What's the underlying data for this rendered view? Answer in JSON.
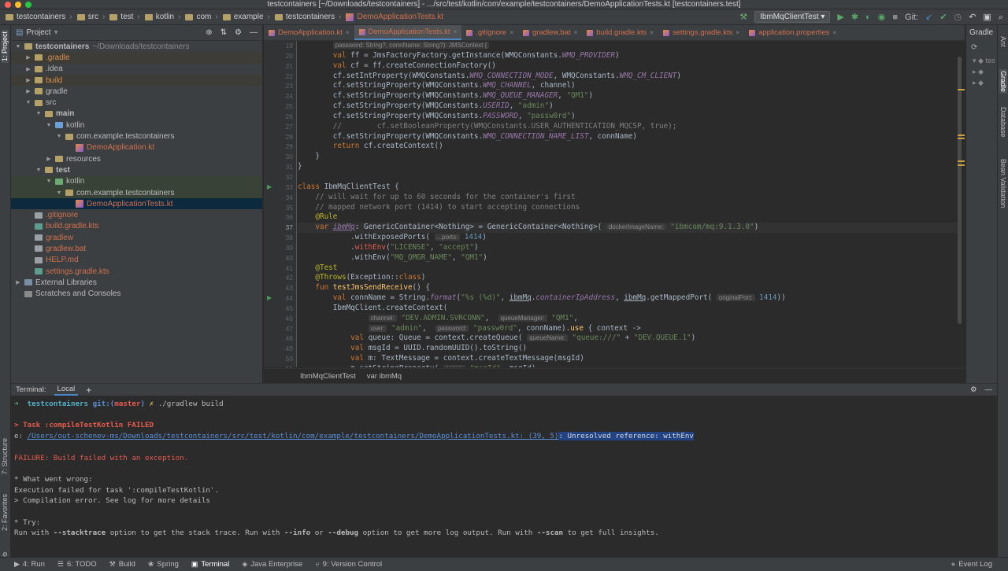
{
  "window": {
    "title": "testcontainers [~/Downloads/testcontainers] - .../src/test/kotlin/com/example/testcontainers/DemoApplicationTests.kt [testcontainers.test]"
  },
  "breadcrumbs": [
    "testcontainers",
    "src",
    "test",
    "kotlin",
    "com",
    "example",
    "testcontainers",
    "DemoApplicationTests.kt"
  ],
  "toolbar": {
    "run_config": "IbmMqClientTest",
    "git_label": "Git:"
  },
  "project": {
    "title": "Project",
    "tree": [
      {
        "label": "testcontainers",
        "suffix": "~/Downloads/testcontainers",
        "indent": 0,
        "arrow": "down",
        "icon": "folder",
        "style": "bold",
        "bg": ""
      },
      {
        "label": ".gradle",
        "indent": 1,
        "arrow": "right",
        "icon": "folder",
        "style": "orange",
        "bg": "ex"
      },
      {
        "label": ".idea",
        "indent": 1,
        "arrow": "right",
        "icon": "folder",
        "style": "",
        "bg": ""
      },
      {
        "label": "build",
        "indent": 1,
        "arrow": "right",
        "icon": "folder",
        "style": "orange",
        "bg": "ex"
      },
      {
        "label": "gradle",
        "indent": 1,
        "arrow": "right",
        "icon": "folder",
        "style": "",
        "bg": ""
      },
      {
        "label": "src",
        "indent": 1,
        "arrow": "down",
        "icon": "folder",
        "style": "",
        "bg": ""
      },
      {
        "label": "main",
        "indent": 2,
        "arrow": "down",
        "icon": "folder",
        "style": "bold",
        "bg": ""
      },
      {
        "label": "kotlin",
        "indent": 3,
        "arrow": "down",
        "icon": "folder-blue",
        "style": "",
        "bg": ""
      },
      {
        "label": "com.example.testcontainers",
        "indent": 4,
        "arrow": "down",
        "icon": "folder",
        "style": "",
        "bg": ""
      },
      {
        "label": "DemoApplication.kt",
        "indent": 5,
        "arrow": "",
        "icon": "kotlin",
        "style": "red",
        "bg": ""
      },
      {
        "label": "resources",
        "indent": 3,
        "arrow": "right",
        "icon": "folder",
        "style": "",
        "bg": ""
      },
      {
        "label": "test",
        "indent": 2,
        "arrow": "down",
        "icon": "folder",
        "style": "bold",
        "bg": ""
      },
      {
        "label": "kotlin",
        "indent": 3,
        "arrow": "down",
        "icon": "folder-green",
        "style": "",
        "bg": "test"
      },
      {
        "label": "com.example.testcontainers",
        "indent": 4,
        "arrow": "down",
        "icon": "folder",
        "style": "",
        "bg": "test"
      },
      {
        "label": "DemoApplicationTests.kt",
        "indent": 5,
        "arrow": "",
        "icon": "kotlin",
        "style": "red",
        "bg": "sel"
      },
      {
        "label": ".gitignore",
        "indent": 1,
        "arrow": "",
        "icon": "file",
        "style": "red",
        "bg": ""
      },
      {
        "label": "build.gradle.kts",
        "indent": 1,
        "arrow": "",
        "icon": "gradle",
        "style": "red",
        "bg": ""
      },
      {
        "label": "gradlew",
        "indent": 1,
        "arrow": "",
        "icon": "file",
        "style": "red",
        "bg": ""
      },
      {
        "label": "gradlew.bat",
        "indent": 1,
        "arrow": "",
        "icon": "file",
        "style": "red",
        "bg": ""
      },
      {
        "label": "HELP.md",
        "indent": 1,
        "arrow": "",
        "icon": "file",
        "style": "red",
        "bg": ""
      },
      {
        "label": "settings.gradle.kts",
        "indent": 1,
        "arrow": "",
        "icon": "gradle",
        "style": "red",
        "bg": ""
      },
      {
        "label": "External Libraries",
        "indent": 0,
        "arrow": "right",
        "icon": "lib",
        "style": "",
        "bg": ""
      },
      {
        "label": "Scratches and Consoles",
        "indent": 0,
        "arrow": "",
        "icon": "scratch",
        "style": "",
        "bg": ""
      }
    ]
  },
  "editor_tabs": [
    {
      "label": "DemoApplication.kt",
      "active": false
    },
    {
      "label": "DemoApplicationTests.kt",
      "active": true
    },
    {
      "label": ".gitignore",
      "active": false
    },
    {
      "label": "gradlew.bat",
      "active": false
    },
    {
      "label": "build.gradle.kts",
      "active": false
    },
    {
      "label": "settings.gradle.kts",
      "active": false
    },
    {
      "label": "application.properties",
      "active": false
    }
  ],
  "editor": {
    "line_numbers": [
      "19",
      "20",
      "21",
      "22",
      "23",
      "24",
      "25",
      "26",
      "27",
      "28",
      "29",
      "30",
      "31",
      "32",
      "33",
      "34",
      "35",
      "36",
      "37",
      "38",
      "39",
      "40",
      "41",
      "42",
      "43",
      "44",
      "45",
      "46",
      "47",
      "48",
      "49",
      "50",
      "51"
    ],
    "current_line": "37",
    "footer": [
      "IbmMqClientTest",
      "var ibmMq"
    ]
  },
  "gradle_panel": {
    "title": "Gradle"
  },
  "left_strip": [
    "1: Project",
    "7: Structure",
    "2: Favorites",
    "Web"
  ],
  "right_strip": [
    "Ant",
    "Gradle",
    "Database",
    "Bean Validation"
  ],
  "terminal": {
    "title": "Terminal:",
    "tab": "Local",
    "prompt_dir": "testcontainers",
    "prompt_git": "git:(",
    "prompt_branch": "master",
    "prompt_git_close": ")",
    "prompt_x": "✗",
    "command": "./gradlew build",
    "task_failed": "> Task :compileTestKotlin FAILED",
    "error_prefix": "e: ",
    "error_path": "/Users/out-schenev-ms/Downloads/testcontainers/src/test/kotlin/com/example/testcontainers/DemoApplicationTests.kt: (39, 5)",
    "error_msg": ": Unresolved reference: withEnv",
    "failure": "FAILURE: Build failed with an exception.",
    "what_wrong": "* What went wrong:",
    "exec_failed": "Execution failed for task ':compileTestKotlin'.",
    "compile_error": "> Compilation error. See log for more details",
    "try": "* Try:",
    "run_with": "Run with ",
    "stacktrace": "--stacktrace",
    "mid1": " option to get the stack trace. Run with ",
    "info": "--info",
    "mid2": " or ",
    "debug": "--debug",
    "mid3": " option to get more log output. Run with ",
    "scan": "--scan",
    "end": " to get full insights."
  },
  "statusbar": [
    {
      "icon": "▶",
      "label": "4: Run"
    },
    {
      "icon": "☰",
      "label": "6: TODO"
    },
    {
      "icon": "⚒",
      "label": "Build"
    },
    {
      "icon": "❀",
      "label": "Spring"
    },
    {
      "icon": "▣",
      "label": "Terminal",
      "active": true
    },
    {
      "icon": "◈",
      "label": "Java Enterprise"
    },
    {
      "icon": "⑂",
      "label": "9: Version Control"
    }
  ],
  "event_log": "Event Log",
  "colors": {
    "accent": "#4a88c7",
    "keyword": "#cc7832",
    "string": "#6a8759",
    "error": "#e55b4f",
    "selection": "#214283"
  }
}
